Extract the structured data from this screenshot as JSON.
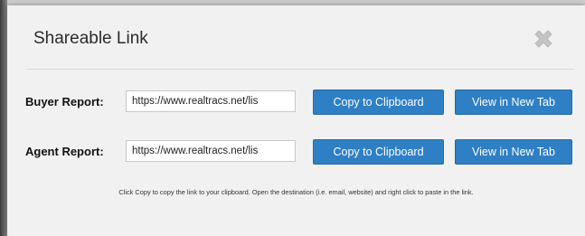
{
  "modal": {
    "title": "Shareable Link",
    "close_icon": "close-x-icon",
    "rows": [
      {
        "label": "Buyer Report:",
        "link_value": "https://www.realtracs.net/lis",
        "copy_label": "Copy to Clipboard",
        "view_label": "View in New Tab"
      },
      {
        "label": "Agent Report:",
        "link_value": "https://www.realtracs.net/lis",
        "copy_label": "Copy to Clipboard",
        "view_label": "View in New Tab"
      }
    ],
    "help_text": "Click Copy to copy the link to your clipboard. Open the destination (i.e. email, website) and right click to paste in the link."
  },
  "colors": {
    "button_bg": "#2f7fc4",
    "modal_bg": "#f1f1f1",
    "close_icon": "#c4c4c4"
  }
}
